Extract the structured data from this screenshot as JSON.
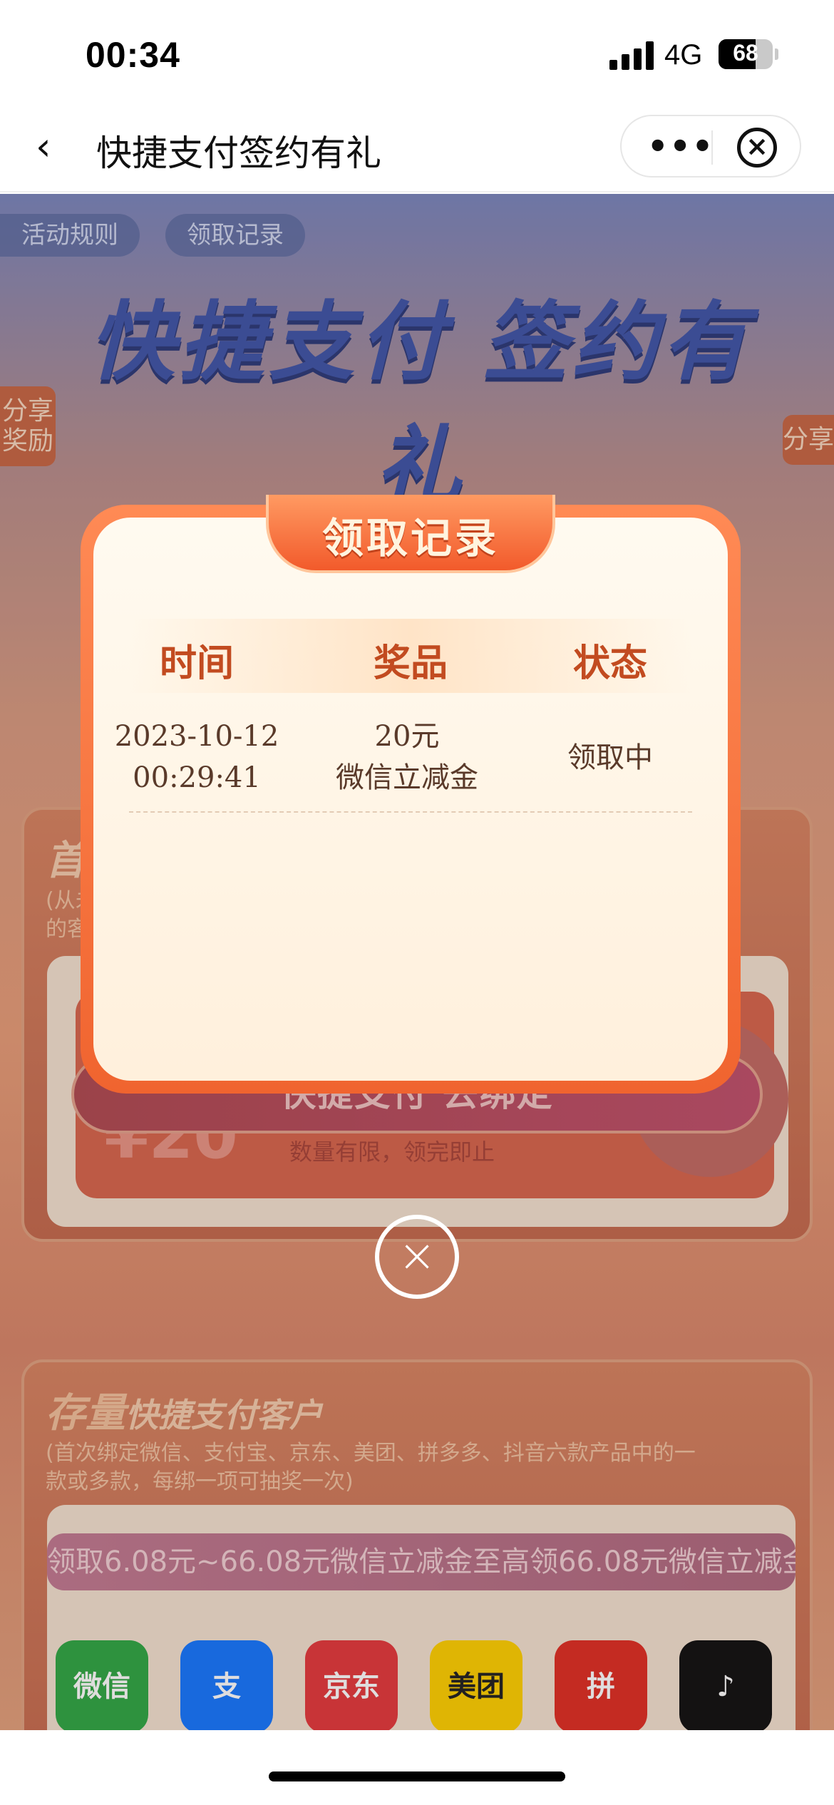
{
  "status_bar": {
    "time": "00:34",
    "network": "4G",
    "battery": "68",
    "battery_level": 0.68
  },
  "nav": {
    "back_icon": "chevron-left-icon",
    "title": "快捷支付签约有礼",
    "more_icon": "more-dots-icon",
    "close_icon": "close-circle-icon"
  },
  "page": {
    "tabs": [
      "活动规则",
      "领取记录"
    ],
    "hero_title": "快捷支付 签约有礼",
    "side_left": "分享奖励",
    "side_right": "分享",
    "first_section_title": "首",
    "first_section_sub": "(从未\n的客",
    "price_symbol": "¥20",
    "limit_text": "数量有限，领完即止",
    "bind_button": "快捷支付 去绑定",
    "existing_title_highlight": "存量",
    "existing_title_rest": "快捷支付客户",
    "existing_sub": "(首次绑定微信、支付宝、京东、美团、拼多多、抖音六款产品中的一款或多款，每绑一项可抽奖一次)",
    "banner_text": "领取6.08元~66.08元微信立减金至高领66.08元微信立减金",
    "apps": [
      {
        "name": "微信",
        "color": "#2fa745"
      },
      {
        "name": "支",
        "color": "#1677ff"
      },
      {
        "name": "京东",
        "color": "#e4393c"
      },
      {
        "name": "美团",
        "color": "#ffd100"
      },
      {
        "name": "拼",
        "color": "#e02e24"
      },
      {
        "name": "♪",
        "color": "#111111"
      }
    ]
  },
  "modal": {
    "title": "领取记录",
    "headers": [
      "时间",
      "奖品",
      "状态"
    ],
    "rows": [
      {
        "date": "2023-10-12",
        "time": "00:29:41",
        "prize_amount": "20元",
        "prize_name": "微信立减金",
        "status": "领取中"
      }
    ],
    "close_icon": "close-circle-icon"
  },
  "colors": {
    "accent": "#f0642f",
    "header_text": "#c24b20"
  }
}
